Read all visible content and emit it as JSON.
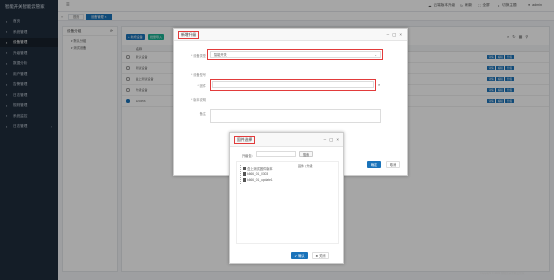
{
  "app": {
    "title": "智能开关智能云管家"
  },
  "sidebar": {
    "items": [
      {
        "label": "首页",
        "active": false,
        "chevron": ""
      },
      {
        "label": "系统管理",
        "active": false,
        "chevron": ""
      },
      {
        "label": "设备管理",
        "active": true,
        "chevron": ""
      },
      {
        "label": "升级管理",
        "active": false,
        "chevron": ""
      },
      {
        "label": "数据分析",
        "active": false,
        "chevron": ""
      },
      {
        "label": "用户管理",
        "active": false,
        "chevron": ""
      },
      {
        "label": "告警管理",
        "active": false,
        "chevron": ""
      },
      {
        "label": "日志管理",
        "active": false,
        "chevron": ""
      },
      {
        "label": "规则管理",
        "active": false,
        "chevron": ""
      },
      {
        "label": "系统监控",
        "active": false,
        "chevron": ""
      },
      {
        "label": "日志管理",
        "active": false,
        "chevron": "‹"
      }
    ]
  },
  "topbar": {
    "links": [
      "云端版本升级",
      "刷新",
      "全屏",
      "切换主题",
      "admin"
    ]
  },
  "tabs": [
    "首页",
    "设备管理"
  ],
  "left_panel": {
    "title": "设备分组",
    "tree": [
      "默认分组",
      "测试设备"
    ]
  },
  "toolbar": {
    "add": "+ 新增设备",
    "import": "批量导入"
  },
  "table": {
    "header": "名称",
    "rows": [
      {
        "name": "默认设备",
        "selected": false
      },
      {
        "name": "测试设备",
        "selected": false
      },
      {
        "name": "盒上测试设备",
        "selected": false
      },
      {
        "name": "升级设备",
        "selected": false
      },
      {
        "name": "123456",
        "selected": true
      }
    ],
    "actions": [
      "详情",
      "编辑",
      "升级"
    ]
  },
  "dialog_outer": {
    "title": "新增升级",
    "fields": [
      {
        "label": "* 设备类型",
        "value": "智能开关"
      },
      {
        "label": "* 设备型号",
        "value": ""
      },
      {
        "label": "* 固件",
        "value": ""
      },
      {
        "label": "* 版本说明",
        "value": ""
      },
      {
        "label": "备注",
        "value": ""
      }
    ],
    "confirm": "确定",
    "cancel": "取消"
  },
  "dialog_inner": {
    "title": "固件选择",
    "filter_label": "升级包：",
    "search_button": "搜索",
    "tree_header": "固件 | 升级",
    "files": [
      "盒上测试固件版本",
      "k666_01_0303",
      "k666_01_update1"
    ],
    "confirm": "✔ 确认",
    "close": "✖ 关闭"
  },
  "footer": {
    "text": "Copyright © 2022 智能开关智能云管家"
  },
  "colors": {
    "accent": "#1a73ba",
    "highlight": "#e23b3b",
    "sidebar": "#1f2d3d"
  }
}
